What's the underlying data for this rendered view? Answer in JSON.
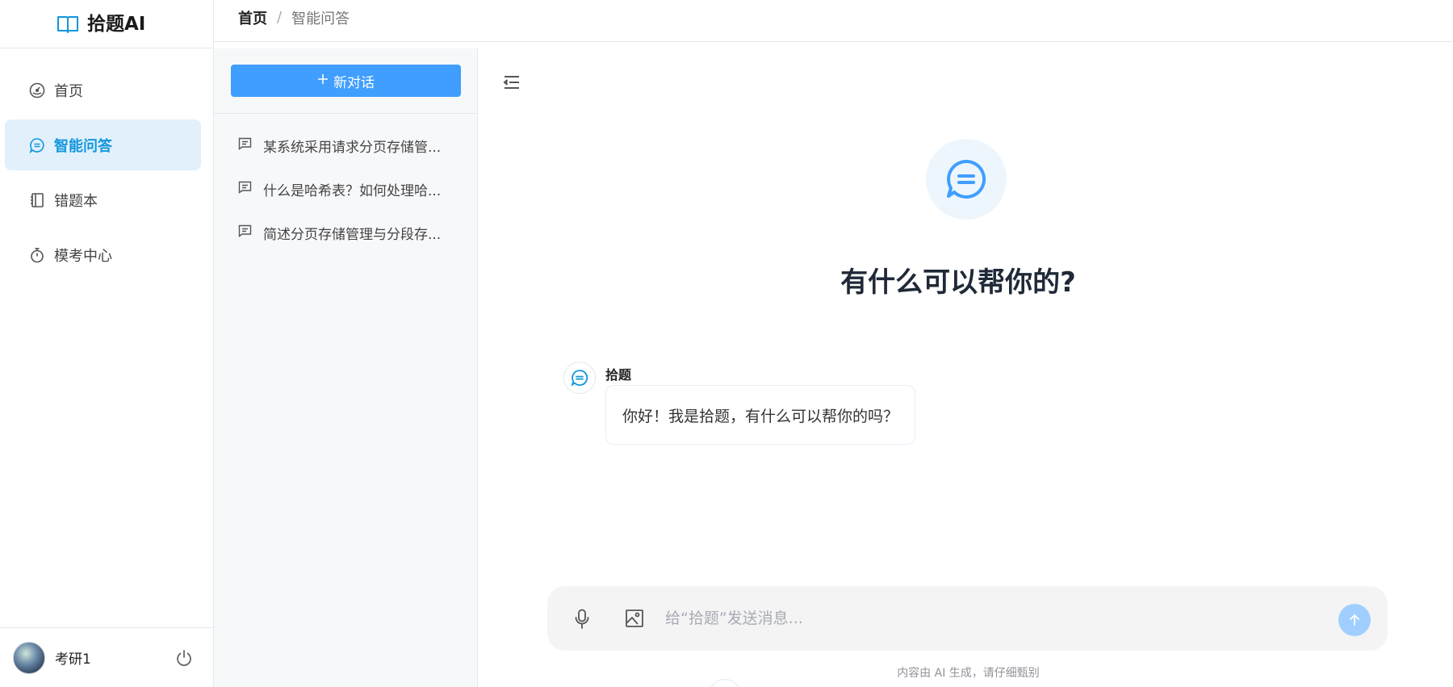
{
  "app": {
    "name": "拾题AI",
    "logo_icon": "book-open-icon"
  },
  "breadcrumb": {
    "home": "首页",
    "separator": "/",
    "current": "智能问答"
  },
  "sidebar": {
    "items": [
      {
        "label": "首页",
        "icon": "dashboard-icon",
        "active": false
      },
      {
        "label": "智能问答",
        "icon": "chat-bubble-icon",
        "active": true
      },
      {
        "label": "错题本",
        "icon": "notebook-icon",
        "active": false
      },
      {
        "label": "模考中心",
        "icon": "timer-icon",
        "active": false
      }
    ],
    "user": {
      "name": "考研1"
    }
  },
  "conversations": {
    "new_label": "新对话",
    "items": [
      {
        "title": "某系统采用请求分页存储管..."
      },
      {
        "title": "什么是哈希表？如何处理哈..."
      },
      {
        "title": "简述分页存储管理与分段存..."
      }
    ]
  },
  "main": {
    "hero_title": "有什么可以帮你的?",
    "message": {
      "sender": "拾题",
      "text": "你好！我是拾题，有什么可以帮你的吗？"
    },
    "input_placeholder": "给“拾题”发送消息...",
    "disclaimer": "内容由 AI 生成，请仔细甄别"
  },
  "colors": {
    "accent": "#409eff",
    "active_bg": "#e1f0fb",
    "active_text": "#1296db",
    "panel_bg": "#f7f8fa"
  }
}
